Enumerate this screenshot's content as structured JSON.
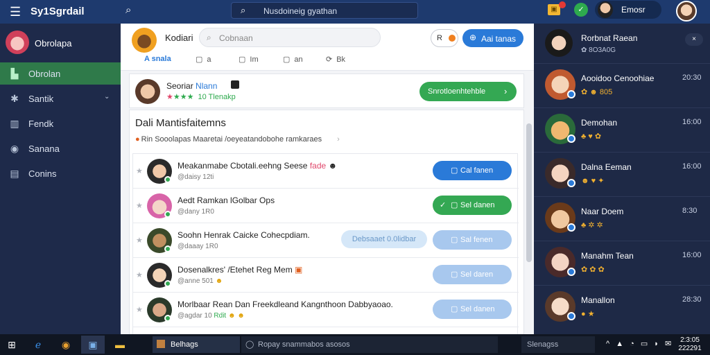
{
  "topbar": {
    "title": "Sy1Sgrdail",
    "search_text": "Nusdoineig gyathan",
    "user_name": "Emosr",
    "menu_icon": "hamburger-icon",
    "search_icon": "search-icon",
    "bell_icon": "notification-icon",
    "status_icon": "status-icon"
  },
  "sidebar": {
    "profile_name": "Obrolapa",
    "items": [
      {
        "label": "Obrolan",
        "icon": "chat-icon",
        "active": true
      },
      {
        "label": "Santik",
        "icon": "gear-icon",
        "active": false
      },
      {
        "label": "Fendk",
        "icon": "chart-icon",
        "active": false
      },
      {
        "label": "Sanana",
        "icon": "globe-icon",
        "active": false
      },
      {
        "label": "Conins",
        "icon": "document-icon",
        "active": false
      }
    ]
  },
  "main": {
    "title": "Kodiari",
    "search_placeholder": "Cobnaan",
    "header_btn_a": "R",
    "header_btn_b": "Aai tanas",
    "tabs": [
      {
        "label": "A snala",
        "icon": "",
        "active": true
      },
      {
        "label": "a",
        "icon": "▢",
        "active": false
      },
      {
        "label": "Im",
        "icon": "▢",
        "active": false
      },
      {
        "label": "an",
        "icon": "▢",
        "active": false
      },
      {
        "label": "Bk",
        "icon": "⟳",
        "active": false
      }
    ],
    "profile": {
      "name": "Seoriar",
      "name_highlight": "Nlann",
      "rating_text": "10 Tlenakp",
      "cta_label": "Snrotloenhtehble"
    },
    "section_title": "Dali Mantisfaitemns",
    "section_sub": "Rin Sooolapas Maaretai /oeyeatandobohe ramkaraes",
    "rows": [
      {
        "title": "Meakanmabe Cbotali.eehng Seese",
        "title_em": "fade",
        "sub": "@daisy 12ti",
        "sub_em": "",
        "button": "Cal fanen",
        "button_style": "blue",
        "chip": ""
      },
      {
        "title": "Aedt Ramkan lGolbar Ops",
        "title_em": "",
        "sub": "@dany 1R0",
        "sub_em": "",
        "button": "Sel danen",
        "button_style": "green",
        "chip": ""
      },
      {
        "title": "Soohn Henrak Caicke Cohecpdiam.",
        "title_em": "",
        "sub": "@daaay 1R0",
        "sub_em": "",
        "button": "Sal fenen",
        "button_style": "pale",
        "chip": "Debsaaet 0.0lidbar"
      },
      {
        "title": "Dosenalkres' /Etehet Reg Mem",
        "title_em": "",
        "sub": "@anne 501",
        "sub_em": "",
        "button": "Sel daren",
        "button_style": "pale",
        "chip": ""
      },
      {
        "title": "Morlbaar Rean Dan Freekdleand Kangnthoon Dabbyaoao.",
        "title_em": "",
        "sub": "@agdar  10",
        "sub_em": "Rdit",
        "button": "Sel danen",
        "button_style": "pale",
        "chip": ""
      }
    ]
  },
  "right_panel": {
    "head_name": "Rorbnat Raean",
    "head_sub": "✿ 8O3A0G",
    "rows": [
      {
        "name": "Aooidoo Cenoohiae",
        "sub": "✿ ☻ 805",
        "time": "20:30"
      },
      {
        "name": "Demohan",
        "sub": "♣ ♥ ✿",
        "time": "16:00"
      },
      {
        "name": "Dalna Eeman",
        "sub": "☻ ♥ ✦",
        "time": "16:00"
      },
      {
        "name": "Naar Doem",
        "sub": "♣ ✲ ✲",
        "time": "8:30"
      },
      {
        "name": "Manahm Tean",
        "sub": "✿ ✿ ✿",
        "time": "16:00"
      },
      {
        "name": "Manallon",
        "sub": "● ★",
        "time": "28:30"
      }
    ]
  },
  "taskbar": {
    "app_label": "Belhags",
    "search_text": "Ropay snammabos asosos",
    "search2_text": "Slenagss",
    "clock_time": "2:3:05",
    "clock_date": "222291"
  }
}
